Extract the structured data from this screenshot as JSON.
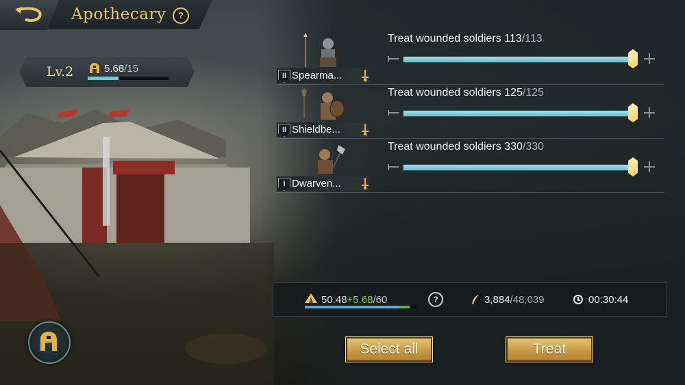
{
  "header": {
    "title": "Apothecary",
    "help_label": "?"
  },
  "level": {
    "label": "Lv.2",
    "capacity_current": "5.68",
    "capacity_max": "/15",
    "capacity_fraction": 0.3787
  },
  "units": [
    {
      "tier": "II",
      "name": "Spearma...",
      "treat_label": "Treat wounded soldiers",
      "treat_current": "113",
      "treat_max": "/113",
      "slider_fraction": 1.0,
      "portrait_icon": "spearman-portrait-icon"
    },
    {
      "tier": "II",
      "name": "Shieldbe...",
      "treat_label": "Treat wounded soldiers",
      "treat_current": "125",
      "treat_max": "/125",
      "slider_fraction": 1.0,
      "portrait_icon": "shieldbearer-portrait-icon"
    },
    {
      "tier": "I",
      "name": "Dwarven...",
      "treat_label": "Treat wounded soldiers",
      "treat_current": "330",
      "treat_max": "/330",
      "slider_fraction": 1.0,
      "portrait_icon": "dwarven-portrait-icon"
    }
  ],
  "summary": {
    "capacity_current": "50.48",
    "capacity_add": "+5.68",
    "capacity_max": "/60",
    "capacity_fraction": 0.8413,
    "capacity_add_fraction": 0.0947,
    "help_label": "?",
    "resource_current": "3,884",
    "resource_max": "/48,039",
    "time": "00:30:44"
  },
  "buttons": {
    "select_all": "Select all",
    "treat": "Treat"
  },
  "colors": {
    "title_gold": "#e8c56a",
    "slider_fill": "#79c9d4",
    "capacity_add_green": "#86d35c",
    "button_gold": "#c99a44"
  }
}
